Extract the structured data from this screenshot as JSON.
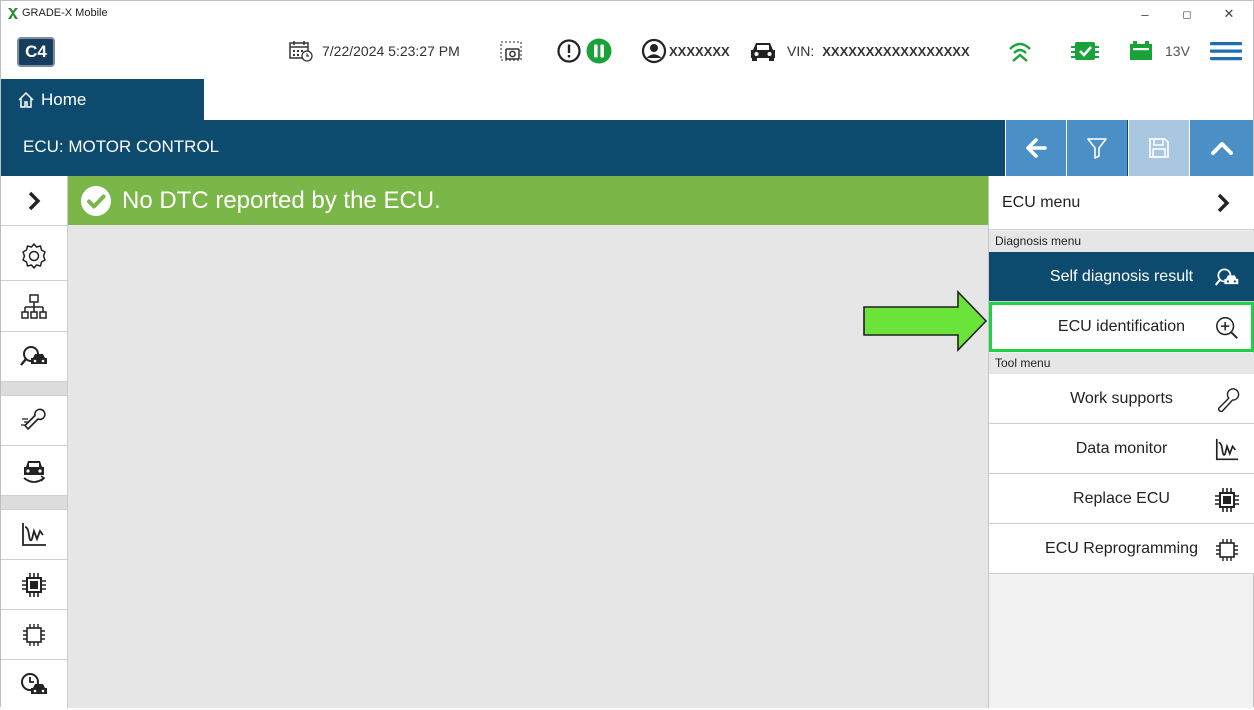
{
  "window": {
    "title": "GRADE-X Mobile",
    "min_label": "–",
    "max_label": "◻",
    "close_label": "✕"
  },
  "toolbar": {
    "logo": "C4",
    "datetime": "7/22/2024 5:23:27 PM",
    "user": "XXXXXXX",
    "vin_label": "VIN:",
    "vin_value": "XXXXXXXXXXXXXXXXX",
    "voltage": "13V",
    "colors": {
      "green": "#1aa23a",
      "blue": "#1e6fb0"
    }
  },
  "tabs": {
    "home": "Home"
  },
  "header": {
    "title": "ECU: MOTOR CONTROL"
  },
  "banner": {
    "message": "No DTC reported by the ECU.",
    "color": "#7ab648"
  },
  "panel": {
    "ecu_menu": "ECU menu",
    "diagnosis_label": "Diagnosis menu",
    "tool_label": "Tool menu",
    "diagnosis_items": [
      {
        "label": "Self diagnosis result",
        "icon": "car-search-icon"
      },
      {
        "label": "ECU identification",
        "icon": "zoom-in-icon"
      }
    ],
    "tool_items": [
      {
        "label": "Work supports",
        "icon": "wrench-icon"
      },
      {
        "label": "Data monitor",
        "icon": "waveform-icon"
      },
      {
        "label": "Replace ECU",
        "icon": "chip-filled-icon"
      },
      {
        "label": "ECU Reprogramming",
        "icon": "chip-outline-icon"
      }
    ]
  },
  "accent": "#0d4b6e",
  "highlight_color": "#22d046",
  "arrow_color": "#6be43a"
}
